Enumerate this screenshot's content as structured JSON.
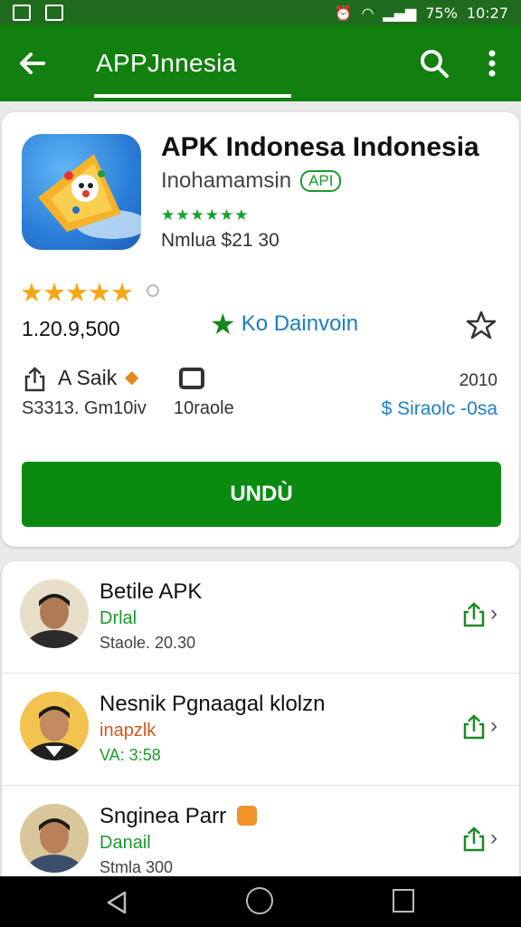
{
  "status_bar": {
    "battery": "75%",
    "time": "10:27"
  },
  "app_bar": {
    "title": "APPJnnesia"
  },
  "app": {
    "name": "APK Indonesa Indonesia",
    "developer": "Inohamamsin",
    "badge": "API",
    "small_stars": "★★★★★★",
    "price_line": "Nmlua $21 30",
    "rating_stars": "★★★★★",
    "download_count": "1.20.9,500",
    "wishlist_label": "Ko Dainvoin",
    "info_label": "A Saik",
    "info_size": "S3313. Gm10iv",
    "device_label": "10raole",
    "year_label": "2010",
    "price_link": "$ Siraolc -0sa",
    "install_label": "UNDÙ"
  },
  "list": {
    "items": [
      {
        "title": "Betile APK",
        "subtitle": "Drlal",
        "meta": "Staole. 20.30"
      },
      {
        "title": "Nesnik Pgnaagal klolzn",
        "subtitle": "inapzlk",
        "meta": "VA: 3:58"
      },
      {
        "title": "Sngineа Parr",
        "subtitle": "Danail",
        "meta": "Stmla 300"
      }
    ]
  },
  "colors": {
    "app_bar": "#12800f",
    "status_bar": "#1e6b1e",
    "install_button": "#0b8a12",
    "accent_green": "#1c9a2d",
    "link_blue": "#1f7fc4",
    "star_orange": "#f4a815"
  },
  "icons": {
    "back": "arrow-left-icon",
    "search": "search-icon",
    "more": "more-vert-icon",
    "favorite": "star-outline-icon",
    "share": "share-icon",
    "device": "device-icon",
    "chevron": "chevron-right-icon"
  }
}
